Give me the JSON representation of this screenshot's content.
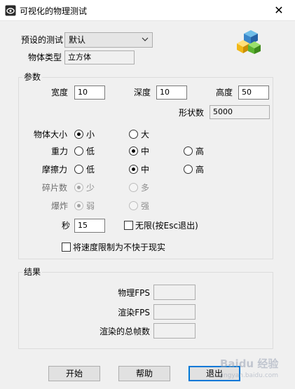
{
  "window": {
    "title": "可视化的物理测试",
    "close_glyph": "✕"
  },
  "preset": {
    "label": "预设的测试",
    "value": "默认"
  },
  "object_type": {
    "label": "物体类型",
    "value": "立方体"
  },
  "params": {
    "title": "参数",
    "width": {
      "label": "宽度",
      "value": "10"
    },
    "depth": {
      "label": "深度",
      "value": "10"
    },
    "height": {
      "label": "高度",
      "value": "50"
    },
    "shape_count": {
      "label": "形状数",
      "value": "5000"
    },
    "object_size": {
      "label": "物体大小",
      "options": [
        "小",
        "大"
      ],
      "selected": 0
    },
    "gravity": {
      "label": "重力",
      "options": [
        "低",
        "中",
        "高"
      ],
      "selected": 1
    },
    "friction": {
      "label": "摩擦力",
      "options": [
        "低",
        "中",
        "高"
      ],
      "selected": 1
    },
    "fragments": {
      "label": "碎片数",
      "options": [
        "少",
        "多"
      ],
      "selected": 0
    },
    "explosion": {
      "label": "爆炸",
      "options": [
        "弱",
        "强"
      ],
      "selected": 0
    },
    "seconds": {
      "label": "秒",
      "value": "15"
    },
    "unlimited": {
      "label": "无限(按Esc退出)",
      "checked": false
    },
    "limit_speed": {
      "label": "将速度限制为不快于现实",
      "checked": false
    }
  },
  "results": {
    "title": "结果",
    "physics_fps": {
      "label": "物理FPS",
      "value": ""
    },
    "render_fps": {
      "label": "渲染FPS",
      "value": ""
    },
    "total_frames": {
      "label": "渲染的总帧数",
      "value": ""
    }
  },
  "buttons": {
    "start": "开始",
    "help": "帮助",
    "exit": "退出"
  },
  "icons": {
    "app": "app-icon",
    "blocks": "blocks-icon",
    "dropdown": "chevron-down-icon",
    "close": "close-icon"
  },
  "colors": {
    "accent": "#0078d7",
    "window_bg": "#f0f0f0"
  },
  "watermark": {
    "text": "Baidu 经验",
    "url_text": "jingyan.baidu.com"
  }
}
